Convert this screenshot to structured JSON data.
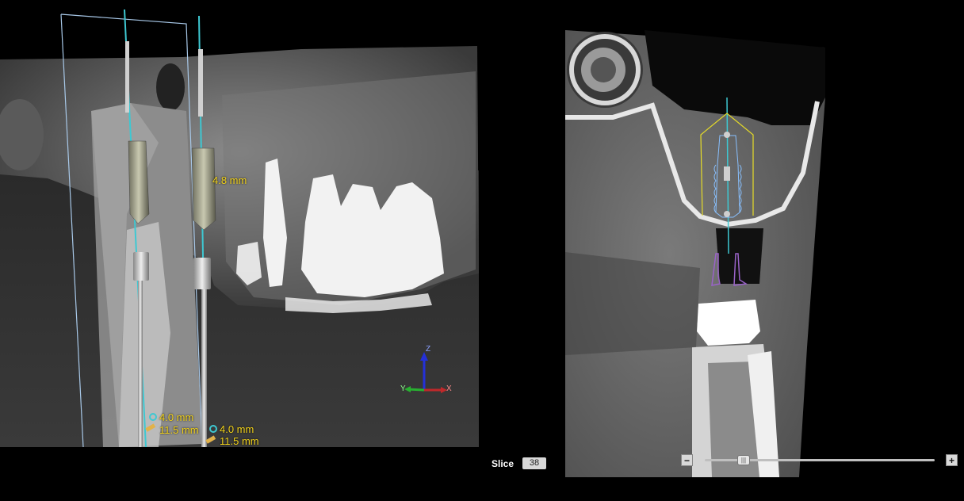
{
  "viewport_3d": {
    "measurements": {
      "implant_a_diameter": "4.0 mm",
      "implant_a_length": "11.5 mm",
      "implant_b_diameter": "4.0 mm",
      "implant_b_length": "11.5 mm",
      "distance": "4.8 mm"
    },
    "axes": {
      "z": "Z",
      "y": "Y",
      "x": "X"
    }
  },
  "slice_controls": {
    "label": "Slice",
    "number": "38",
    "zoom_out": "−",
    "zoom_in": "+",
    "zoom_level": 0.15
  },
  "colors": {
    "measurement_text": "#f2d21a",
    "implant_axis": "#3ec8d2",
    "slice_plane": "#a8c8e8",
    "implant_outline": "#88c0ff",
    "safety_zone": "#e6dc28",
    "abutment_outline": "#9a63c8"
  }
}
